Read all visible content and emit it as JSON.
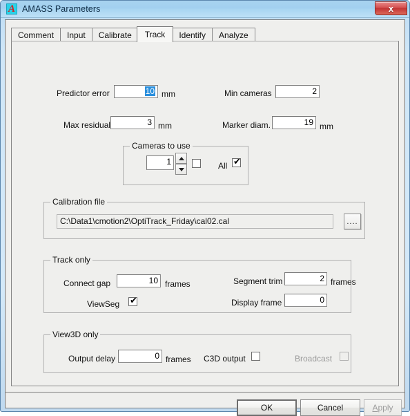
{
  "window": {
    "title": "AMASS Parameters",
    "icon_name": "amass-app-icon",
    "icon_glyph": "A",
    "close_glyph": "x",
    "accent_titlebar": "#a8d3ef",
    "accent_close": "#c13434",
    "accent_selection": "#2a8fdd"
  },
  "tabs": [
    {
      "label": "Comment",
      "active": false
    },
    {
      "label": "Input",
      "active": false
    },
    {
      "label": "Calibrate",
      "active": false
    },
    {
      "label": "Track",
      "active": true
    },
    {
      "label": "Identify",
      "active": false
    },
    {
      "label": "Analyze",
      "active": false
    }
  ],
  "fields": {
    "predictor_error": {
      "label": "Predictor error",
      "value": "10",
      "unit": "mm",
      "selected": true
    },
    "min_cameras": {
      "label": "Min cameras",
      "value": "2",
      "unit": ""
    },
    "max_residual": {
      "label": "Max residual",
      "value": "3",
      "unit": "mm"
    },
    "marker_diam": {
      "label": "Marker diam.",
      "value": "19",
      "unit": "mm"
    }
  },
  "cameras_group": {
    "title": "Cameras to use",
    "count_value": "1",
    "spinner_up": "spinner-up-icon",
    "spinner_down": "spinner-down-icon",
    "single_checkbox_checked": false,
    "all_label": "All",
    "all_checked": true,
    "check_glyph": "✔"
  },
  "calibration_group": {
    "title": "Calibration file",
    "path": "C:\\Data1\\cmotion2\\OptiTrack_Friday\\cal02.cal",
    "browse_label": "...."
  },
  "track_group": {
    "title": "Track only",
    "connect_gap": {
      "label": "Connect gap",
      "value": "10",
      "unit": "frames"
    },
    "segment_trim": {
      "label": "Segment trim",
      "value": "2",
      "unit": "frames"
    },
    "viewseg": {
      "label": "ViewSeg",
      "checked": true
    },
    "display_frame": {
      "label": "Display frame",
      "value": "0",
      "unit": ""
    }
  },
  "view3d_group": {
    "title": "View3D only",
    "output_delay": {
      "label": "Output delay",
      "value": "0",
      "unit": "frames"
    },
    "c3d_output": {
      "label": "C3D output",
      "checked": false
    },
    "broadcast": {
      "label": "Broadcast",
      "checked": false,
      "disabled": true
    }
  },
  "buttons": {
    "ok": "OK",
    "cancel": "Cancel",
    "apply_accel": "A",
    "apply_rest": "pply"
  }
}
